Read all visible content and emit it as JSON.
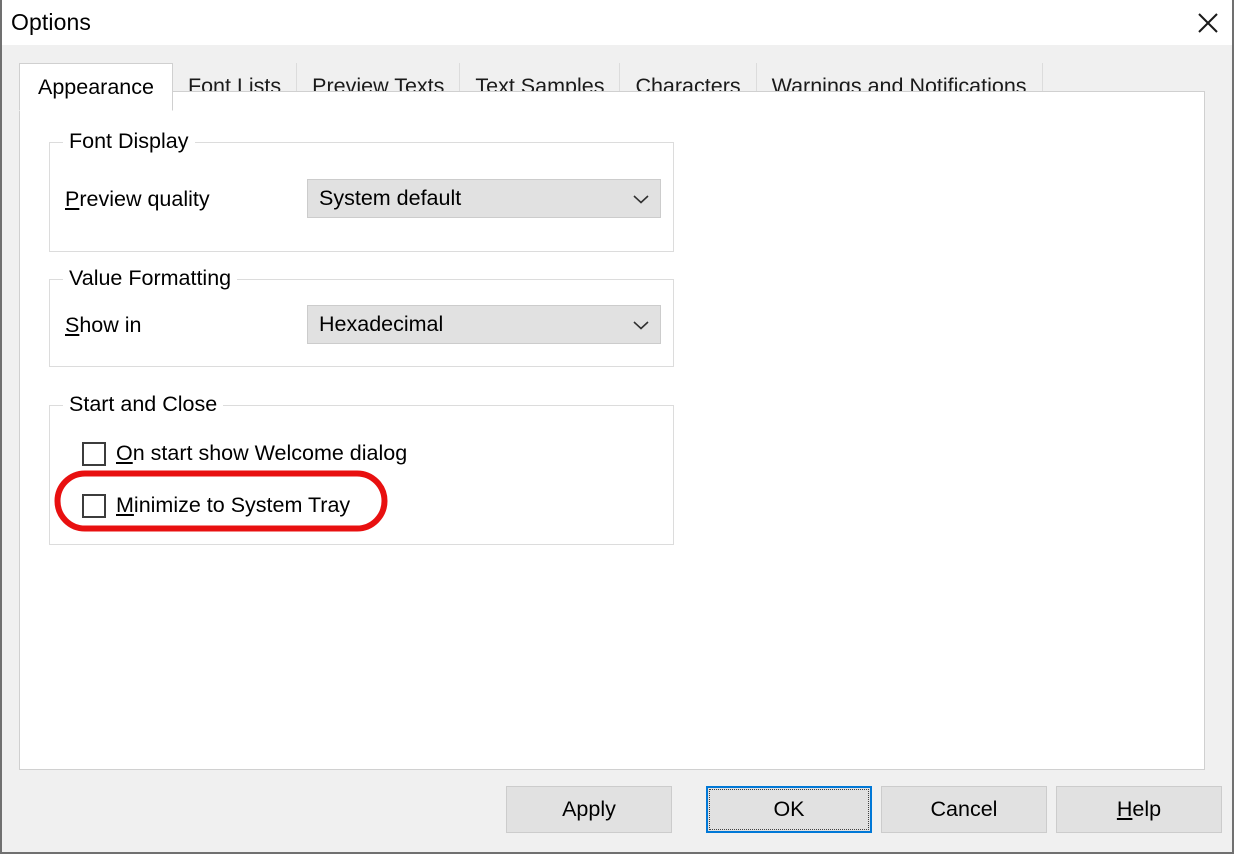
{
  "window": {
    "title": "Options",
    "close_icon": "close-icon"
  },
  "tabs": [
    {
      "label": "Appearance",
      "active": true
    },
    {
      "label": "Font Lists",
      "active": false
    },
    {
      "label": "Preview Texts",
      "active": false
    },
    {
      "label": "Text Samples",
      "active": false
    },
    {
      "label": "Characters",
      "active": false
    },
    {
      "label": "Warnings and Notifications",
      "active": false
    }
  ],
  "groups": {
    "font_display": {
      "title": "Font Display",
      "preview_quality": {
        "label_prefix": "",
        "label_mnemonic": "P",
        "label_suffix": "review quality",
        "value": "System default",
        "arrow_icon": "chevron-down-icon"
      }
    },
    "value_formatting": {
      "title": "Value Formatting",
      "show_in": {
        "label_prefix": "",
        "label_mnemonic": "S",
        "label_suffix": "how in",
        "value": "Hexadecimal",
        "arrow_icon": "chevron-down-icon"
      }
    },
    "start_and_close": {
      "title": "Start and Close",
      "checkboxes": [
        {
          "label_prefix": "",
          "label_mnemonic": "O",
          "label_suffix": "n start show Welcome dialog",
          "checked": false
        },
        {
          "label_prefix": "",
          "label_mnemonic": "M",
          "label_suffix": "inimize to System Tray",
          "checked": false,
          "highlighted": true
        }
      ]
    }
  },
  "annotation": {
    "shape": "ellipse-highlight",
    "color": "#e81010",
    "target": "Minimize to System Tray"
  },
  "footer": {
    "buttons": [
      {
        "label": "Apply",
        "mnemonic": "",
        "default": false
      },
      {
        "label": "OK",
        "mnemonic": "",
        "default": true,
        "focused": true
      },
      {
        "label": "Cancel",
        "mnemonic": "",
        "default": false
      },
      {
        "label": "Help",
        "mnemonic": "H",
        "default": false
      }
    ]
  },
  "colors": {
    "accent": "#0078d7",
    "annotation_red": "#e81010",
    "panel_bg": "#ffffff",
    "chrome_bg": "#f0f0f0",
    "control_bg": "#e1e1e1"
  }
}
